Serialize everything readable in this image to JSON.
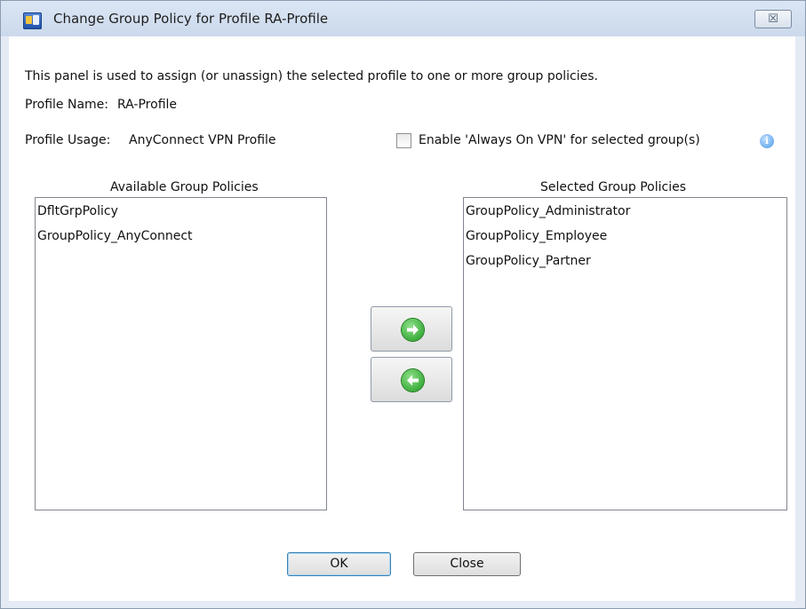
{
  "window": {
    "title": "Change Group Policy for Profile RA-Profile",
    "close_glyph": "☒"
  },
  "panel": {
    "description": "This panel is used to assign (or unassign) the selected profile to one or more group policies.",
    "profile_name_label": "Profile Name:",
    "profile_name_value": "RA-Profile",
    "profile_usage_label": "Profile Usage:",
    "profile_usage_value": "AnyConnect VPN Profile",
    "always_on_label": "Enable 'Always On VPN' for selected group(s)",
    "always_on_checked": false,
    "info_glyph": "i"
  },
  "available": {
    "header": "Available Group Policies",
    "items": [
      "DfltGrpPolicy",
      "GroupPolicy_AnyConnect"
    ]
  },
  "selected": {
    "header": "Selected Group Policies",
    "items": [
      "GroupPolicy_Administrator",
      "GroupPolicy_Employee",
      "GroupPolicy_Partner"
    ]
  },
  "buttons": {
    "ok": "OK",
    "close": "Close"
  },
  "icons": {
    "app": "asdm-app-icon",
    "close": "close-icon",
    "info": "info-icon",
    "add": "arrow-right-icon",
    "remove": "arrow-left-icon"
  },
  "colors": {
    "titlebar": "#d4e1f2",
    "arrow_green": "#1c9a1c",
    "info_blue": "#4c97e6"
  }
}
